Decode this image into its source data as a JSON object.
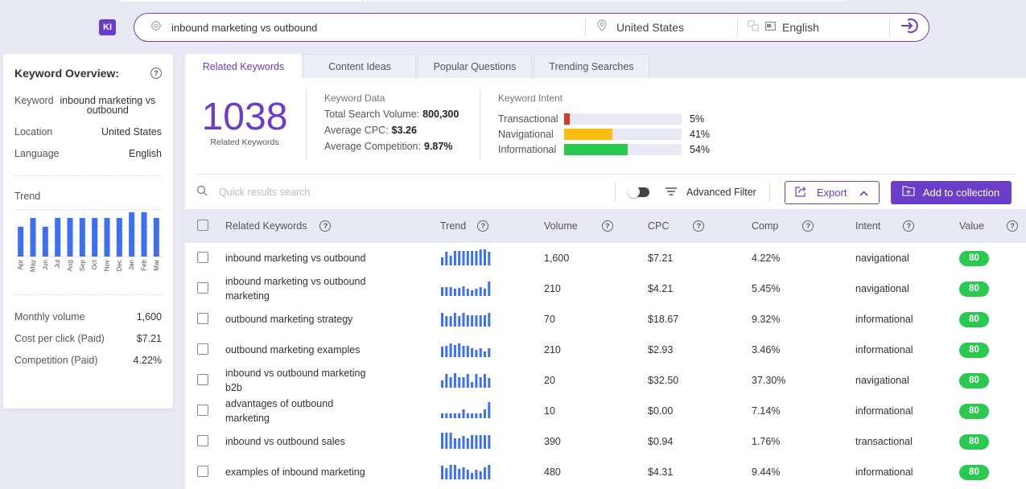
{
  "app": {
    "logo_text": "KI"
  },
  "search": {
    "keyword": "inbound marketing vs outbound",
    "location": "United States",
    "language": "English",
    "icons": {
      "keyword": "crosshair-icon",
      "location": "location-pin-icon",
      "translate": "translate-icon",
      "language": "language-icon",
      "go": "enter-arrow-icon"
    }
  },
  "sidebar": {
    "title": "Keyword Overview:",
    "keyword_label": "Keyword",
    "keyword_value": "inbound marketing vs outbound",
    "location_label": "Location",
    "location_value": "United States",
    "language_label": "Language",
    "language_value": "English",
    "trend_label": "Trend",
    "trend": {
      "type": "bar",
      "months": [
        "Apr",
        "May",
        "Jun",
        "Jul",
        "Aug",
        "Sep",
        "Oct",
        "Nov",
        "Dec",
        "Jan",
        "Feb",
        "Mar"
      ],
      "values": [
        0.67,
        0.87,
        0.67,
        0.87,
        0.87,
        0.87,
        0.87,
        0.87,
        0.87,
        1.0,
        1.0,
        0.87
      ],
      "color": "#3d6ff2"
    },
    "monthly_volume_label": "Monthly volume",
    "monthly_volume": "1,600",
    "cpc_label": "Cost per click (Paid)",
    "cpc": "$7.21",
    "competition_label": "Competition (Paid)",
    "competition": "4.22%"
  },
  "tabs": [
    {
      "label": "Related Keywords",
      "active": true
    },
    {
      "label": "Content Ideas",
      "active": false
    },
    {
      "label": "Popular Questions",
      "active": false
    },
    {
      "label": "Trending Searches",
      "active": false
    }
  ],
  "summary": {
    "count": "1038",
    "count_label": "Related Keywords",
    "keyword_data_title": "Keyword Data",
    "total_volume_label": "Total Search Volume:",
    "total_volume": "800,300",
    "avg_cpc_label": "Average CPC:",
    "avg_cpc": "$3.26",
    "avg_comp_label": "Average Competition:",
    "avg_comp": "9.87%",
    "intent_title": "Keyword Intent",
    "intents": [
      {
        "label": "Transactional",
        "pct_text": "5%",
        "pct": 5,
        "color": "#d9382b"
      },
      {
        "label": "Navigational",
        "pct_text": "41%",
        "pct": 41,
        "color": "#fbbd14"
      },
      {
        "label": "Informational",
        "pct_text": "54%",
        "pct": 54,
        "color": "#2ac94f"
      }
    ]
  },
  "toolbar": {
    "search_placeholder": "Quick results search",
    "advanced_filter": "Advanced Filter",
    "export": "Export",
    "add_to_collection": "Add to collection"
  },
  "table": {
    "headers": {
      "keyword": "Related Keywords",
      "trend": "Trend",
      "volume": "Volume",
      "cpc": "CPC",
      "comp": "Comp",
      "intent": "Intent",
      "value": "Value"
    },
    "rows": [
      {
        "keyword": "inbound marketing vs outbound",
        "trend": [
          0.5,
          0.85,
          0.6,
          0.9,
          0.9,
          0.9,
          0.9,
          0.9,
          0.9,
          1,
          1,
          0.85
        ],
        "volume": "1,600",
        "cpc": "$7.21",
        "comp": "4.22%",
        "intent": "navigational",
        "value": "80"
      },
      {
        "keyword": "inbound marketing vs outbound marketing",
        "trend": [
          0.55,
          0.55,
          0.55,
          0.45,
          0.5,
          0.6,
          0.45,
          0.35,
          0.45,
          0.55,
          0.45,
          0.9
        ],
        "volume": "210",
        "cpc": "$4.21",
        "comp": "5.45%",
        "intent": "navigational",
        "value": "80"
      },
      {
        "keyword": "outbound marketing strategy",
        "trend": [
          0.85,
          0.65,
          0.65,
          0.85,
          0.65,
          0.85,
          0.7,
          0.7,
          0.7,
          0.7,
          0.7,
          0.85
        ],
        "volume": "70",
        "cpc": "$18.67",
        "comp": "9.32%",
        "intent": "informational",
        "value": "80"
      },
      {
        "keyword": "outbound marketing examples",
        "trend": [
          0.65,
          0.7,
          0.85,
          0.75,
          0.85,
          0.7,
          0.7,
          0.55,
          0.45,
          0.55,
          0.35,
          0.55
        ],
        "volume": "210",
        "cpc": "$2.93",
        "comp": "3.46%",
        "intent": "informational",
        "value": "80"
      },
      {
        "keyword": "inbound vs outbound marketing b2b",
        "trend": [
          0.45,
          0.85,
          0.65,
          0.9,
          0.65,
          0.65,
          0.85,
          0.35,
          0.85,
          0.65,
          0.85,
          0.6
        ],
        "volume": "20",
        "cpc": "$32.50",
        "comp": "37.30%",
        "intent": "navigational",
        "value": "80"
      },
      {
        "keyword": "advantages of outbound marketing",
        "trend": [
          0.3,
          0.3,
          0.3,
          0.3,
          0.3,
          0.55,
          0.3,
          0.3,
          0.3,
          0.3,
          0.55,
          1
        ],
        "volume": "10",
        "cpc": "$0.00",
        "comp": "7.14%",
        "intent": "informational",
        "value": "80"
      },
      {
        "keyword": "inbound vs outbound sales",
        "trend": [
          1,
          1,
          1,
          0.65,
          0.65,
          0.8,
          0.65,
          0.85,
          0.85,
          0.85,
          0.85,
          0.85
        ],
        "volume": "390",
        "cpc": "$0.94",
        "comp": "1.76%",
        "intent": "transactional",
        "value": "80"
      },
      {
        "keyword": "examples of inbound marketing",
        "trend": [
          0.85,
          0.7,
          0.9,
          0.9,
          0.65,
          0.75,
          0.6,
          0.4,
          0.6,
          0.5,
          0.75,
          0.9
        ],
        "volume": "480",
        "cpc": "$4.31",
        "comp": "9.44%",
        "intent": "informational",
        "value": "80"
      }
    ]
  }
}
